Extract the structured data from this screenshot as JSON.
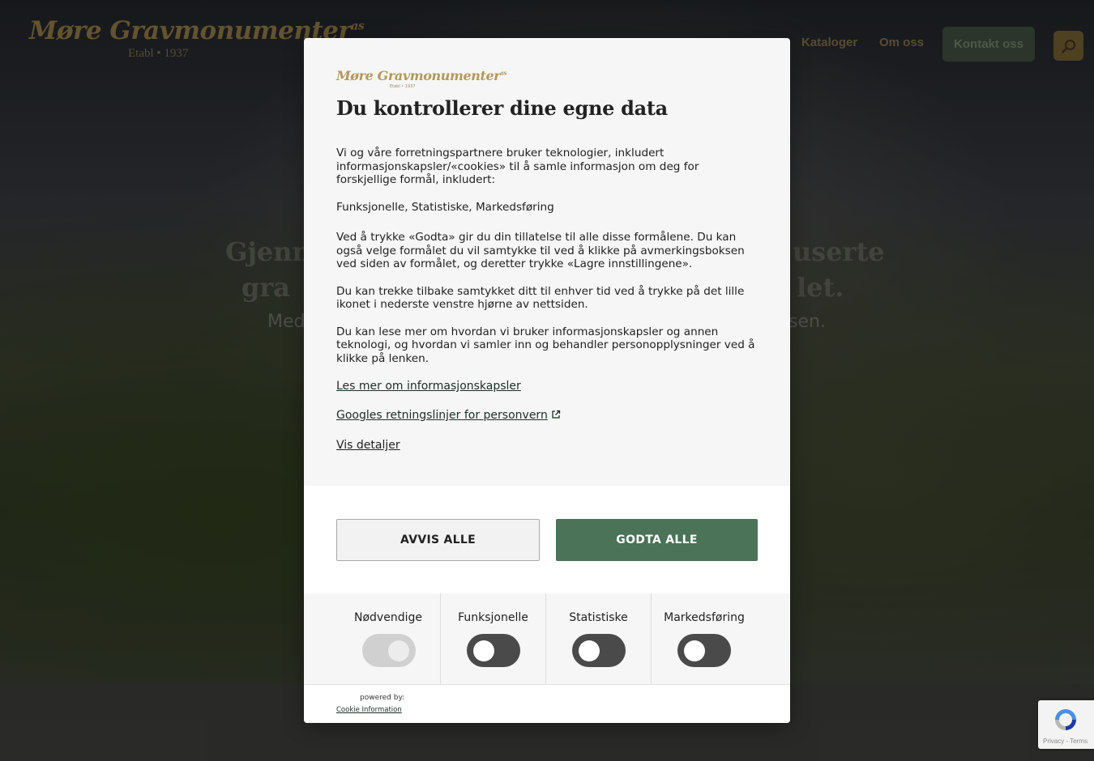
{
  "site": {
    "logo_text": "Møre Gravmonumenter",
    "logo_suffix": "as",
    "logo_tagline": "Etabl • 1937",
    "nav": {
      "kataloger": "Kataloger",
      "om_oss": "Om oss",
      "kontakt": "Kontakt oss"
    },
    "hero": {
      "left_line1": "Gjenn",
      "left_line2": "gra",
      "right_line1": "userte",
      "right_line2": "let.",
      "sub_left": "Med",
      "sub_right": "sen."
    },
    "recaptcha_text": "Privacy - Terms"
  },
  "dialog": {
    "logo_text": "Møre Gravmonumenter",
    "logo_suffix": "as",
    "logo_tagline": "Etabl • 1937",
    "title": "Du kontrollerer dine egne data",
    "paragraphs": {
      "intro": "Vi og våre forretningspartnere bruker teknologier, inkludert informasjonskapsler/«cookies» til å samle informasjon om deg for forskjellige formål, inkludert:",
      "purposes": "Funksjonelle, Statistiske, Markedsføring",
      "consent": "Ved å trykke «Godta» gir du din tillatelse til alle disse formålene. Du kan også velge formålet du vil samtykke til ved å klikke på avmerkingsboksen ved siden av formålet, og deretter trykke «Lagre innstillingene».",
      "withdraw": "Du kan trekke tilbake samtykket ditt til enhver tid ved å trykke på det lille ikonet i nederste venstre hjørne av nettsiden.",
      "read_more": "Du kan lese mer om hvordan vi bruker informasjonskapsler og annen teknologi, og hvordan vi samler inn og behandler personopplysninger ved å klikke på lenken."
    },
    "links": {
      "cookies": "Les mer om informasjonskapsler",
      "google": "Googles retningslinjer for personvern",
      "details": "Vis detaljer"
    },
    "buttons": {
      "reject": "AVVIS ALLE",
      "accept": "GODTA ALLE"
    },
    "toggles": [
      {
        "label": "Nødvendige",
        "state": "on-disabled"
      },
      {
        "label": "Funksjonelle",
        "state": "off"
      },
      {
        "label": "Statistiske",
        "state": "off"
      },
      {
        "label": "Markedsføring",
        "state": "off"
      }
    ],
    "powered_by": "powered by:",
    "powered_link": "Cookie Information"
  },
  "colors": {
    "accept_button": "#4a7358",
    "toggle_off": "#4a4a4a",
    "logo_gold": "#b4975a"
  }
}
